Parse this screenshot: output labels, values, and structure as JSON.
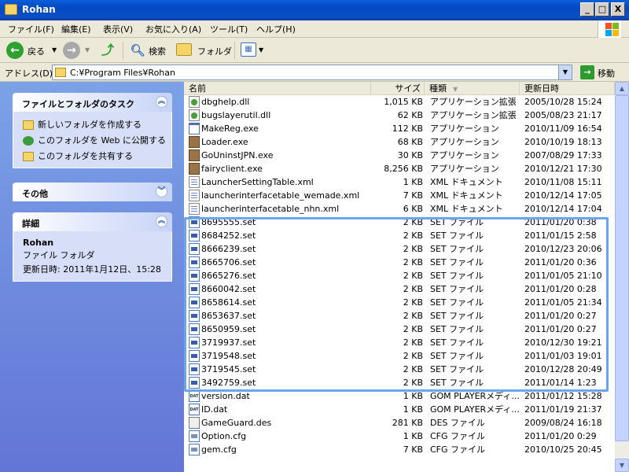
{
  "window": {
    "title": "Rohan",
    "controls": {
      "minimize": "_",
      "maximize": "□",
      "close": "X"
    }
  },
  "menu": [
    "ファイル(F)",
    "編集(E)",
    "表示(V)",
    "お気に入り(A)",
    "ツール(T)",
    "ヘルプ(H)"
  ],
  "toolbar": {
    "back_label": "戻る",
    "search_label": "検索",
    "folders_label": "フォルダ"
  },
  "address": {
    "label": "アドレス(D)",
    "path": "C:¥Program Files¥Rohan",
    "go_label": "移動"
  },
  "tasks_panel": {
    "title": "ファイルとフォルダのタスク",
    "items": [
      "新しいフォルダを作成する",
      "このフォルダを Web に公開する",
      "このフォルダを共有する"
    ]
  },
  "other_panel": {
    "title": "その他"
  },
  "details_panel": {
    "title": "詳細",
    "name": "Rohan",
    "kind": "ファイル フォルダ",
    "modified": "更新日時: 2011年1月12日、15:28"
  },
  "columns": {
    "name": "名前",
    "size": "サイズ",
    "type": "種類",
    "date": "更新日時"
  },
  "files": [
    {
      "icon": "dll",
      "name": "dbghelp.dll",
      "size": "1,015 KB",
      "type": "アプリケーション拡張",
      "date": "2005/10/28 15:24"
    },
    {
      "icon": "dll",
      "name": "bugslayerutil.dll",
      "size": "62 KB",
      "type": "アプリケーション拡張",
      "date": "2005/08/23 21:17"
    },
    {
      "icon": "exe-w",
      "name": "MakeReg.exe",
      "size": "112 KB",
      "type": "アプリケーション",
      "date": "2010/11/09 16:54"
    },
    {
      "icon": "exe-p",
      "name": "Loader.exe",
      "size": "68 KB",
      "type": "アプリケーション",
      "date": "2010/10/19 18:13"
    },
    {
      "icon": "exe-p",
      "name": "GoUninstJPN.exe",
      "size": "30 KB",
      "type": "アプリケーション",
      "date": "2007/08/29 17:33"
    },
    {
      "icon": "exe-p",
      "name": "fairyclient.exe",
      "size": "8,256 KB",
      "type": "アプリケーション",
      "date": "2010/12/21 17:30"
    },
    {
      "icon": "xml",
      "name": "LauncherSettingTable.xml",
      "size": "1 KB",
      "type": "XML ドキュメント",
      "date": "2010/11/08 15:11"
    },
    {
      "icon": "xml",
      "name": "launcherinterfacetable_wemade.xml",
      "size": "7 KB",
      "type": "XML ドキュメント",
      "date": "2010/12/14 17:05"
    },
    {
      "icon": "xml",
      "name": "launcherinterfacetable_nhn.xml",
      "size": "6 KB",
      "type": "XML ドキュメント",
      "date": "2010/12/14 17:04"
    },
    {
      "icon": "set",
      "name": "8695555.set",
      "size": "2 KB",
      "type": "SET ファイル",
      "date": "2011/01/20 0:38"
    },
    {
      "icon": "set",
      "name": "8684252.set",
      "size": "2 KB",
      "type": "SET ファイル",
      "date": "2011/01/15 2:58"
    },
    {
      "icon": "set",
      "name": "8666239.set",
      "size": "2 KB",
      "type": "SET ファイル",
      "date": "2010/12/23 20:06"
    },
    {
      "icon": "set",
      "name": "8665706.set",
      "size": "2 KB",
      "type": "SET ファイル",
      "date": "2011/01/20 0:36"
    },
    {
      "icon": "set",
      "name": "8665276.set",
      "size": "2 KB",
      "type": "SET ファイル",
      "date": "2011/01/05 21:10"
    },
    {
      "icon": "set",
      "name": "8660042.set",
      "size": "2 KB",
      "type": "SET ファイル",
      "date": "2011/01/20 0:28"
    },
    {
      "icon": "set",
      "name": "8658614.set",
      "size": "2 KB",
      "type": "SET ファイル",
      "date": "2011/01/05 21:34"
    },
    {
      "icon": "set",
      "name": "8653637.set",
      "size": "2 KB",
      "type": "SET ファイル",
      "date": "2011/01/20 0:27"
    },
    {
      "icon": "set",
      "name": "8650959.set",
      "size": "2 KB",
      "type": "SET ファイル",
      "date": "2011/01/20 0:27"
    },
    {
      "icon": "set",
      "name": "3719937.set",
      "size": "2 KB",
      "type": "SET ファイル",
      "date": "2010/12/30 19:21"
    },
    {
      "icon": "set",
      "name": "3719548.set",
      "size": "2 KB",
      "type": "SET ファイル",
      "date": "2011/01/03 19:01"
    },
    {
      "icon": "set",
      "name": "3719545.set",
      "size": "2 KB",
      "type": "SET ファイル",
      "date": "2010/12/28 20:49"
    },
    {
      "icon": "set",
      "name": "3492759.set",
      "size": "2 KB",
      "type": "SET ファイル",
      "date": "2011/01/14 1:23"
    },
    {
      "icon": "dat",
      "name": "version.dat",
      "size": "1 KB",
      "type": "GOM PLAYERメディ...",
      "date": "2011/01/12 15:28"
    },
    {
      "icon": "dat",
      "name": "ID.dat",
      "size": "1 KB",
      "type": "GOM PLAYERメディ...",
      "date": "2011/01/19 21:37"
    },
    {
      "icon": "des",
      "name": "GameGuard.des",
      "size": "281 KB",
      "type": "DES ファイル",
      "date": "2009/08/24 16:18"
    },
    {
      "icon": "cfg",
      "name": "Option.cfg",
      "size": "1 KB",
      "type": "CFG ファイル",
      "date": "2011/01/20 0:29"
    },
    {
      "icon": "cfg",
      "name": "gem.cfg",
      "size": "7 KB",
      "type": "CFG ファイル",
      "date": "2010/10/25 20:45"
    }
  ],
  "colors": {
    "title_bar": "#0348c2",
    "left_pane": "#6f8ce0",
    "highlight_box": "#6aa5ee"
  }
}
